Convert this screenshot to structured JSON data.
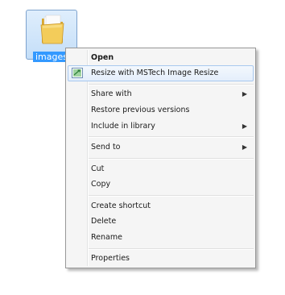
{
  "desktop": {
    "folder": {
      "label": "images",
      "icon": "folder-icon"
    }
  },
  "context_menu": {
    "items": [
      {
        "label": "Open",
        "bold": true
      },
      {
        "label": "Resize with MSTech Image Resize",
        "icon": "image-resize-icon",
        "highlighted": true
      },
      {
        "label": "Share with",
        "submenu": true
      },
      {
        "label": "Restore previous versions"
      },
      {
        "label": "Include in library",
        "submenu": true
      },
      {
        "label": "Send to",
        "submenu": true
      },
      {
        "label": "Cut"
      },
      {
        "label": "Copy"
      },
      {
        "label": "Create shortcut"
      },
      {
        "label": "Delete"
      },
      {
        "label": "Rename"
      },
      {
        "label": "Properties"
      }
    ],
    "submenu_arrow": "▶"
  },
  "colors": {
    "selection": "#3399ff",
    "menu_background": "#f5f5f5",
    "highlight_border": "#a8c8ef"
  }
}
